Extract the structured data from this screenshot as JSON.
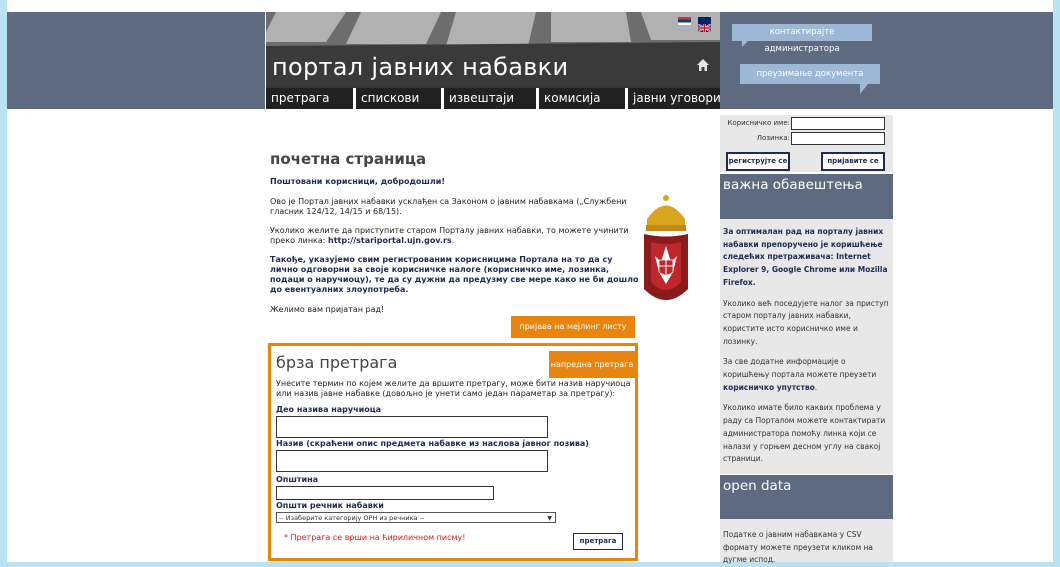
{
  "header": {
    "site_title": "портал јавних набавки",
    "nav": [
      "претрага",
      "спискови",
      "извештаји",
      "комисија",
      "јавни уговори"
    ]
  },
  "right_panel": {
    "contact_label": "контактирајте администратора",
    "download_label": "преузимање документа"
  },
  "login": {
    "username_label": "Корисничко име:",
    "password_label": "Лозинка:",
    "register_label": "региструјте се",
    "login_label": "пријавите се"
  },
  "main": {
    "title": "почетна страница",
    "greeting": "Поштовани корисници, добродошли!",
    "p1": "Ово је Портал јавних набавки усклађен са Законом о јавним набавкама („Службени гласник 124/12, 14/15 и 68/15).",
    "p2_prefix": "Уколико желите да приступите старом Порталу јавних набавки, то можете учинити преко линка: ",
    "p2_link": "http://stariportal.ujn.gov.rs",
    "p2_suffix": ".",
    "p3": "Такође, указујемо свим регистрованим корисницима Портала на то да су лично одговорни за своје корисничке налоге (корисничко име, лозинка, подаци о наручиоцу), те да су дужни да предузму све мере како не би дошло до евентуалних злоупотреба.",
    "p4": "Желимо вам пријатан рад!",
    "mailing_button": "пријава на мејлинг листу"
  },
  "search": {
    "title": "брза претрага",
    "advanced_button": "напредна претрага",
    "description": "Унесите термин по којем желите да вршите претрагу, може бити назив наручиоца или назив јавне набавке (довољно је унети само један параметар за претрагу):",
    "field1_label": "Део назива наручиоца",
    "field2_label": "Назив (скраћени опис предмета набавке из наслова јавног позива)",
    "field3_label": "Општина",
    "field4_label": "Општи речник набавки",
    "select_value": "-- Изаберите категорију ОРН из речника --",
    "note": "* Претрага се врши на ћириличном писму!",
    "submit_label": "претрага"
  },
  "notices": {
    "title": "важна обавештења",
    "p1": "За оптималан рад на порталу јавних набавки препоручено је коришћење следећих претраживача: Internet Explorer 9, Google Chrome или Mozilla Firefox.",
    "p2": "Уколико већ поседујете налог за приступ старом порталу јавних набавки, користите исто корисничко име и лозинку.",
    "p3_prefix": "За све додатне информације о коришћењу портала можете преузети ",
    "p3_link": "корисничко упутство",
    "p3_suffix": ".",
    "p4": "Уколико имате било каквих проблема у раду са Порталом можете контактирати администратора помоћу линка који се налази у горњем десном углу на свакој страници."
  },
  "open_data": {
    "title": "open data",
    "text": "Податке о јавним набавкама у CSV формату можете преузети кликом на дугме испод."
  }
}
